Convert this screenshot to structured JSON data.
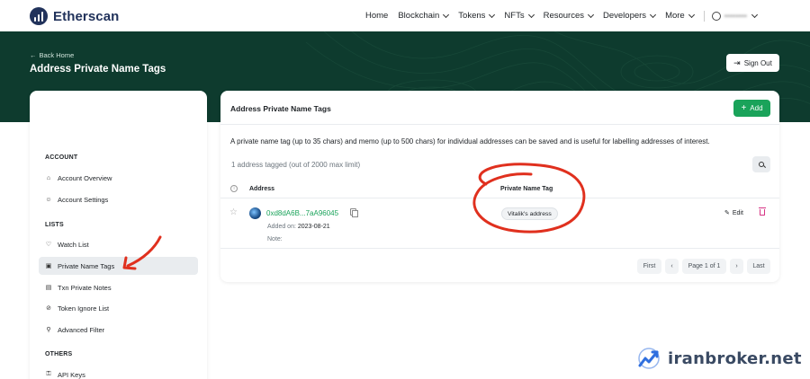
{
  "nav": {
    "logo_text": "Etherscan",
    "items": [
      {
        "label": "Home",
        "has_caret": false
      },
      {
        "label": "Blockchain",
        "has_caret": true
      },
      {
        "label": "Tokens",
        "has_caret": true
      },
      {
        "label": "NFTs",
        "has_caret": true
      },
      {
        "label": "Resources",
        "has_caret": true
      },
      {
        "label": "Developers",
        "has_caret": true
      },
      {
        "label": "More",
        "has_caret": true
      }
    ],
    "user_label": "••••••••"
  },
  "hero": {
    "back_label": "Back Home",
    "title": "Address Private Name Tags",
    "signout_label": "Sign Out"
  },
  "sidebar": {
    "sections": [
      {
        "title": "ACCOUNT",
        "items": [
          {
            "label": "Account Overview",
            "icon": "home-icon",
            "active": false
          },
          {
            "label": "Account Settings",
            "icon": "user-icon",
            "active": false
          }
        ]
      },
      {
        "title": "LISTS",
        "items": [
          {
            "label": "Watch List",
            "icon": "heart-icon",
            "active": false
          },
          {
            "label": "Private Name Tags",
            "icon": "tag-note-icon",
            "active": true
          },
          {
            "label": "Txn Private Notes",
            "icon": "note-icon",
            "active": false
          },
          {
            "label": "Token Ignore List",
            "icon": "eye-slash-icon",
            "active": false
          },
          {
            "label": "Advanced Filter",
            "icon": "filter-icon",
            "active": false
          }
        ]
      },
      {
        "title": "OTHERS",
        "items": [
          {
            "label": "API Keys",
            "icon": "key-icon",
            "active": false
          }
        ]
      }
    ]
  },
  "card": {
    "title": "Address Private Name Tags",
    "add_label": "Add",
    "description": "A private name tag (up to 35 chars) and memo (up to 500 chars) for individual addresses can be saved and is useful for labelling addresses of interest.",
    "count_text": "1 address tagged (out of 2000 max limit)",
    "columns": {
      "address": "Address",
      "tag": "Private Name Tag"
    },
    "rows": [
      {
        "address": "0xd8dA6B...7aA96045",
        "added_label": "Added on:",
        "added_date": "2023-08-21",
        "note_label": "Note:",
        "tag": "Vitalik's address",
        "edit_label": "Edit"
      }
    ],
    "pager": {
      "first": "First",
      "prev": "‹",
      "page": "Page 1 of 1",
      "next": "›",
      "last": "Last"
    }
  },
  "colors": {
    "brand_dark": "#21325b",
    "hero_bg": "#0e3b2e",
    "accent_green": "#1aa35a",
    "annotation_red": "#e0301e"
  },
  "watermark": {
    "text": "iranbroker.net"
  }
}
